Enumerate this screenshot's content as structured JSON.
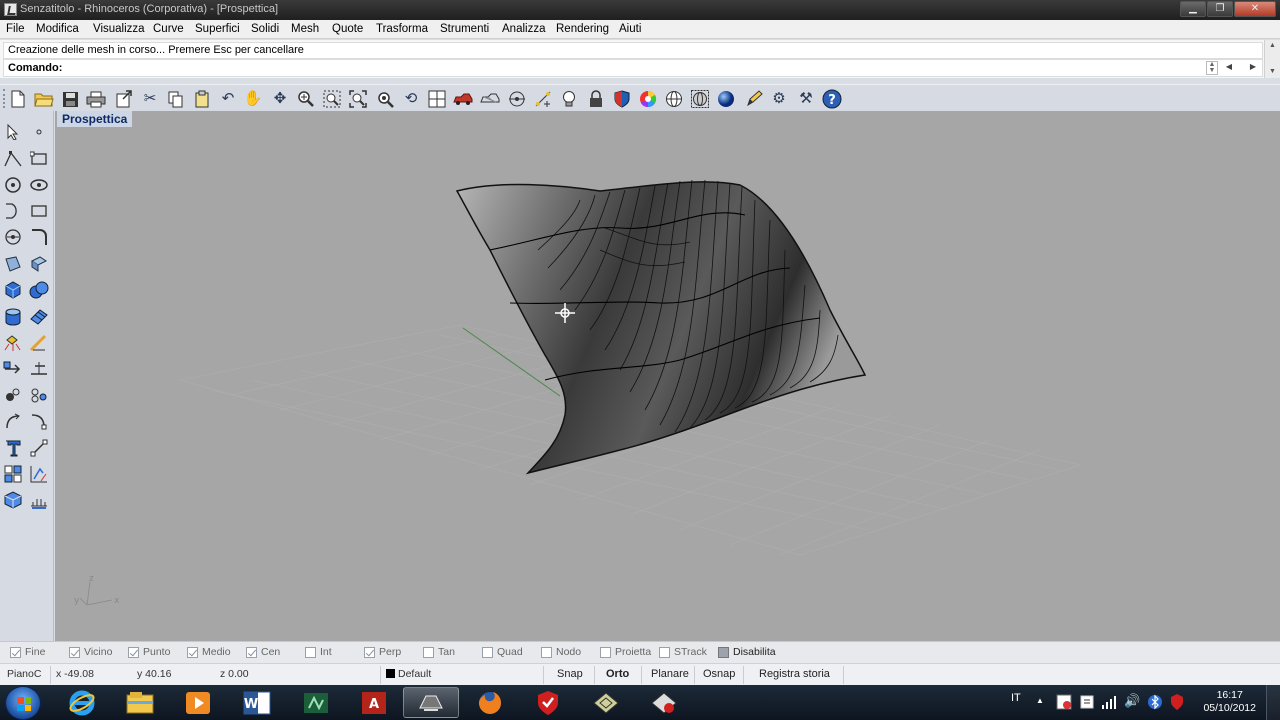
{
  "window": {
    "title": "Senzatitolo - Rhinoceros (Corporativa) - [Prospettica]",
    "minimize_glyph": "▁",
    "restore_glyph": "❐",
    "close_glyph": "✕"
  },
  "menu": [
    "File",
    "Modifica",
    "Visualizza",
    "Curve",
    "Superfici",
    "Solidi",
    "Mesh",
    "Quote",
    "Trasforma",
    "Strumenti",
    "Analizza",
    "Rendering",
    "Aiuti"
  ],
  "command": {
    "history": "Creazione delle mesh in corso... Premere Esc per cancellare",
    "label": "Comando:",
    "value": ""
  },
  "viewport": {
    "tab_label": "Prospettica",
    "axis_labels": {
      "z": "z",
      "y": "y",
      "x": "x"
    }
  },
  "top_toolbar_icons": [
    "new-file-icon",
    "open-folder-icon",
    "save-icon",
    "print-icon",
    "export-icon",
    "cut-icon",
    "copy-icon",
    "paste-icon",
    "undo-icon",
    "pan-hand-icon",
    "move-view-icon",
    "zoom-icon",
    "zoom-window-icon",
    "zoom-extents-icon",
    "zoom-selected-icon",
    "four-viewports-icon",
    "car-render-icon",
    "wireframe-car-icon",
    "point-icon",
    "snap-grid-icon",
    "light-bulb-icon",
    "lock-icon",
    "shield-icon",
    "color-wheel-icon",
    "sphere-wireframe-icon",
    "sphere-mesh-icon",
    "render-sphere-icon",
    "pencil-tool-icon",
    "gear-options-icon",
    "tools-icon",
    "help-icon"
  ],
  "osnap": [
    {
      "label": "Fine",
      "checked": true
    },
    {
      "label": "Vicino",
      "checked": true
    },
    {
      "label": "Punto",
      "checked": true
    },
    {
      "label": "Medio",
      "checked": true
    },
    {
      "label": "Cen",
      "checked": true
    },
    {
      "label": "Int",
      "checked": false
    },
    {
      "label": "Perp",
      "checked": true
    },
    {
      "label": "Tan",
      "checked": false
    },
    {
      "label": "Quad",
      "checked": false
    },
    {
      "label": "Nodo",
      "checked": false
    },
    {
      "label": "Proietta",
      "checked": false
    },
    {
      "label": "STrack",
      "checked": false
    },
    {
      "label": "Disabilita",
      "checked": true
    }
  ],
  "status": {
    "cplane": "PianoC",
    "x": "x -49.08",
    "y": "y 40.16",
    "z": "z 0.00",
    "layer": "Default",
    "snap": "Snap",
    "orto": "Orto",
    "planare": "Planare",
    "osnap": "Osnap",
    "history": "Registra storia"
  },
  "taskbar": {
    "language": "IT",
    "time": "16:17",
    "date": "05/10/2012",
    "apps": [
      "internet-explorer-icon",
      "file-explorer-icon",
      "media-player-icon",
      "word-icon",
      "rhino-notepad-icon",
      "acrobat-icon",
      "rhino-active-icon",
      "firefox-icon",
      "antivirus-icon",
      "rhino-cad-icon",
      "rhino-template-icon"
    ],
    "word_letter": "W",
    "acrobat_letter": "A",
    "show_hidden_glyph": "▲",
    "volume_glyph": "🔊"
  }
}
